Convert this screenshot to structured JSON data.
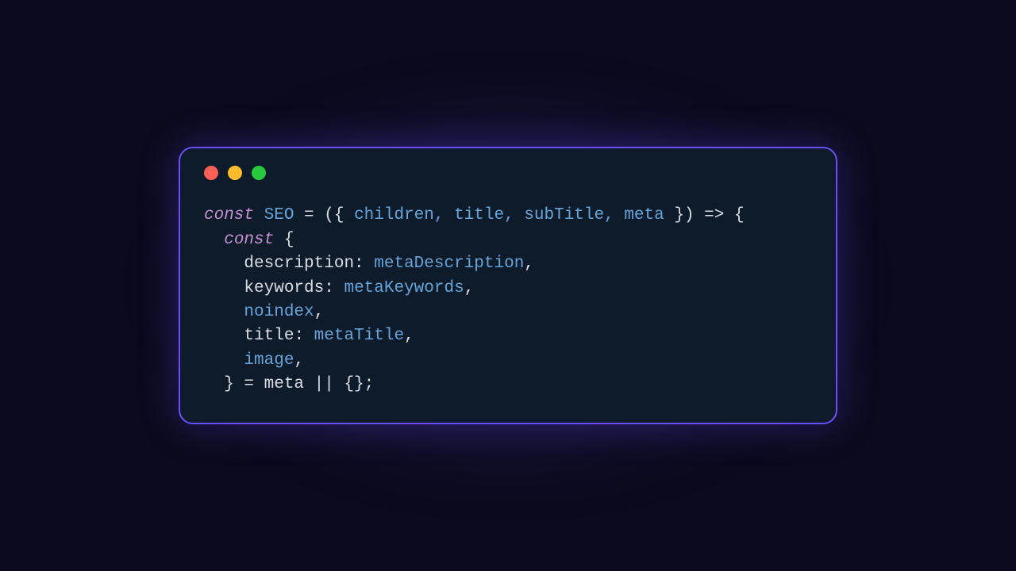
{
  "code": {
    "line1": {
      "kw": "const",
      "func": " SEO",
      "rest1": " = ({ ",
      "params": "children, title, subTitle, meta",
      "rest2": " }) => {"
    },
    "line2": {
      "indent": "  ",
      "kw": "const",
      "rest": " {"
    },
    "line3": {
      "indent": "    ",
      "prop": "description",
      "colon": ": ",
      "var": "metaDescription",
      "comma": ","
    },
    "line4": {
      "indent": "    ",
      "prop": "keywords",
      "colon": ": ",
      "var": "metaKeywords",
      "comma": ","
    },
    "line5": {
      "indent": "    ",
      "var": "noindex",
      "comma": ","
    },
    "line6": {
      "indent": "    ",
      "prop": "title",
      "colon": ": ",
      "var": "metaTitle",
      "comma": ","
    },
    "line7": {
      "indent": "    ",
      "var": "image",
      "comma": ","
    },
    "line8": {
      "indent": "  ",
      "rest": "} = meta || {};"
    }
  }
}
